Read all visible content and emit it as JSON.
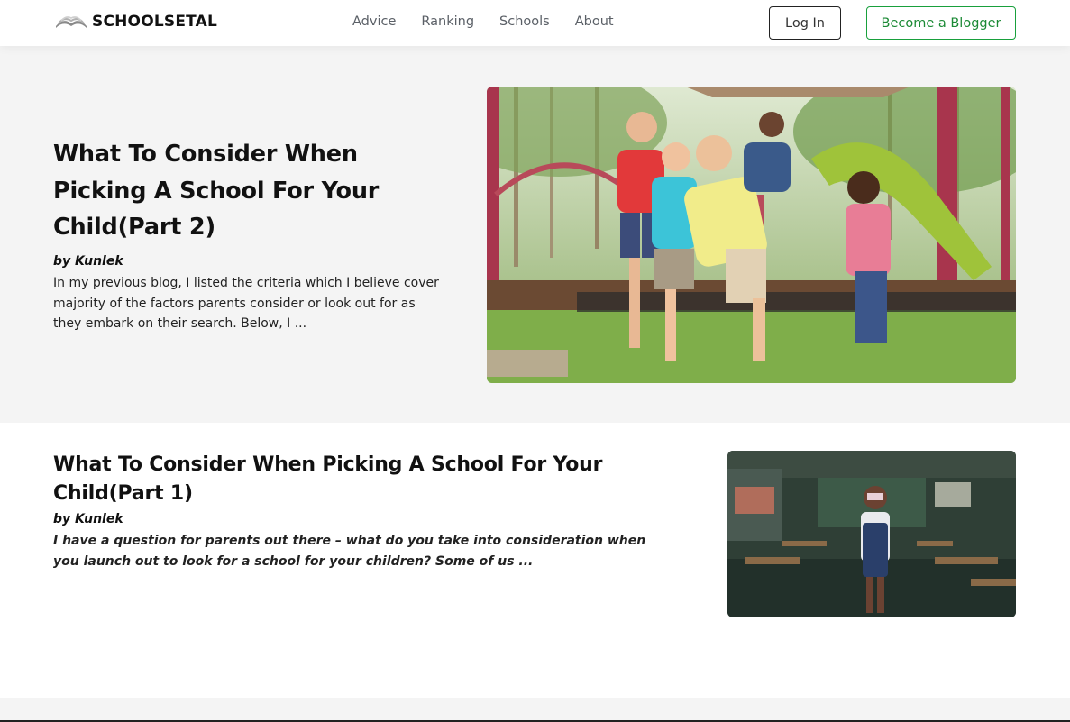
{
  "brand": {
    "name": "SCHOOLSETAL"
  },
  "nav": {
    "items": [
      "Advice",
      "Ranking",
      "Schools",
      "About"
    ]
  },
  "auth": {
    "login_label": "Log In",
    "blogger_label": "Become a Blogger"
  },
  "colors": {
    "accent_green": "#18a03c",
    "hero_bg": "#f4f4f4",
    "nav_text": "#5b6067"
  },
  "featured": {
    "title": "What To Consider When Picking A School For Your Child(Part 2)",
    "author": "by Kunlek",
    "excerpt": "In my previous blog, I listed the criteria which I believe cover majority of the factors parents consider or look out for as they embark on their search. Below, I ..."
  },
  "posts": [
    {
      "title": "What To Consider When Picking A School For Your Child(Part 1)",
      "author": "by Kunlek",
      "excerpt": "I have a question for parents out there – what do you take into consideration when you launch out to look for a school for your children? Some of us ..."
    }
  ]
}
